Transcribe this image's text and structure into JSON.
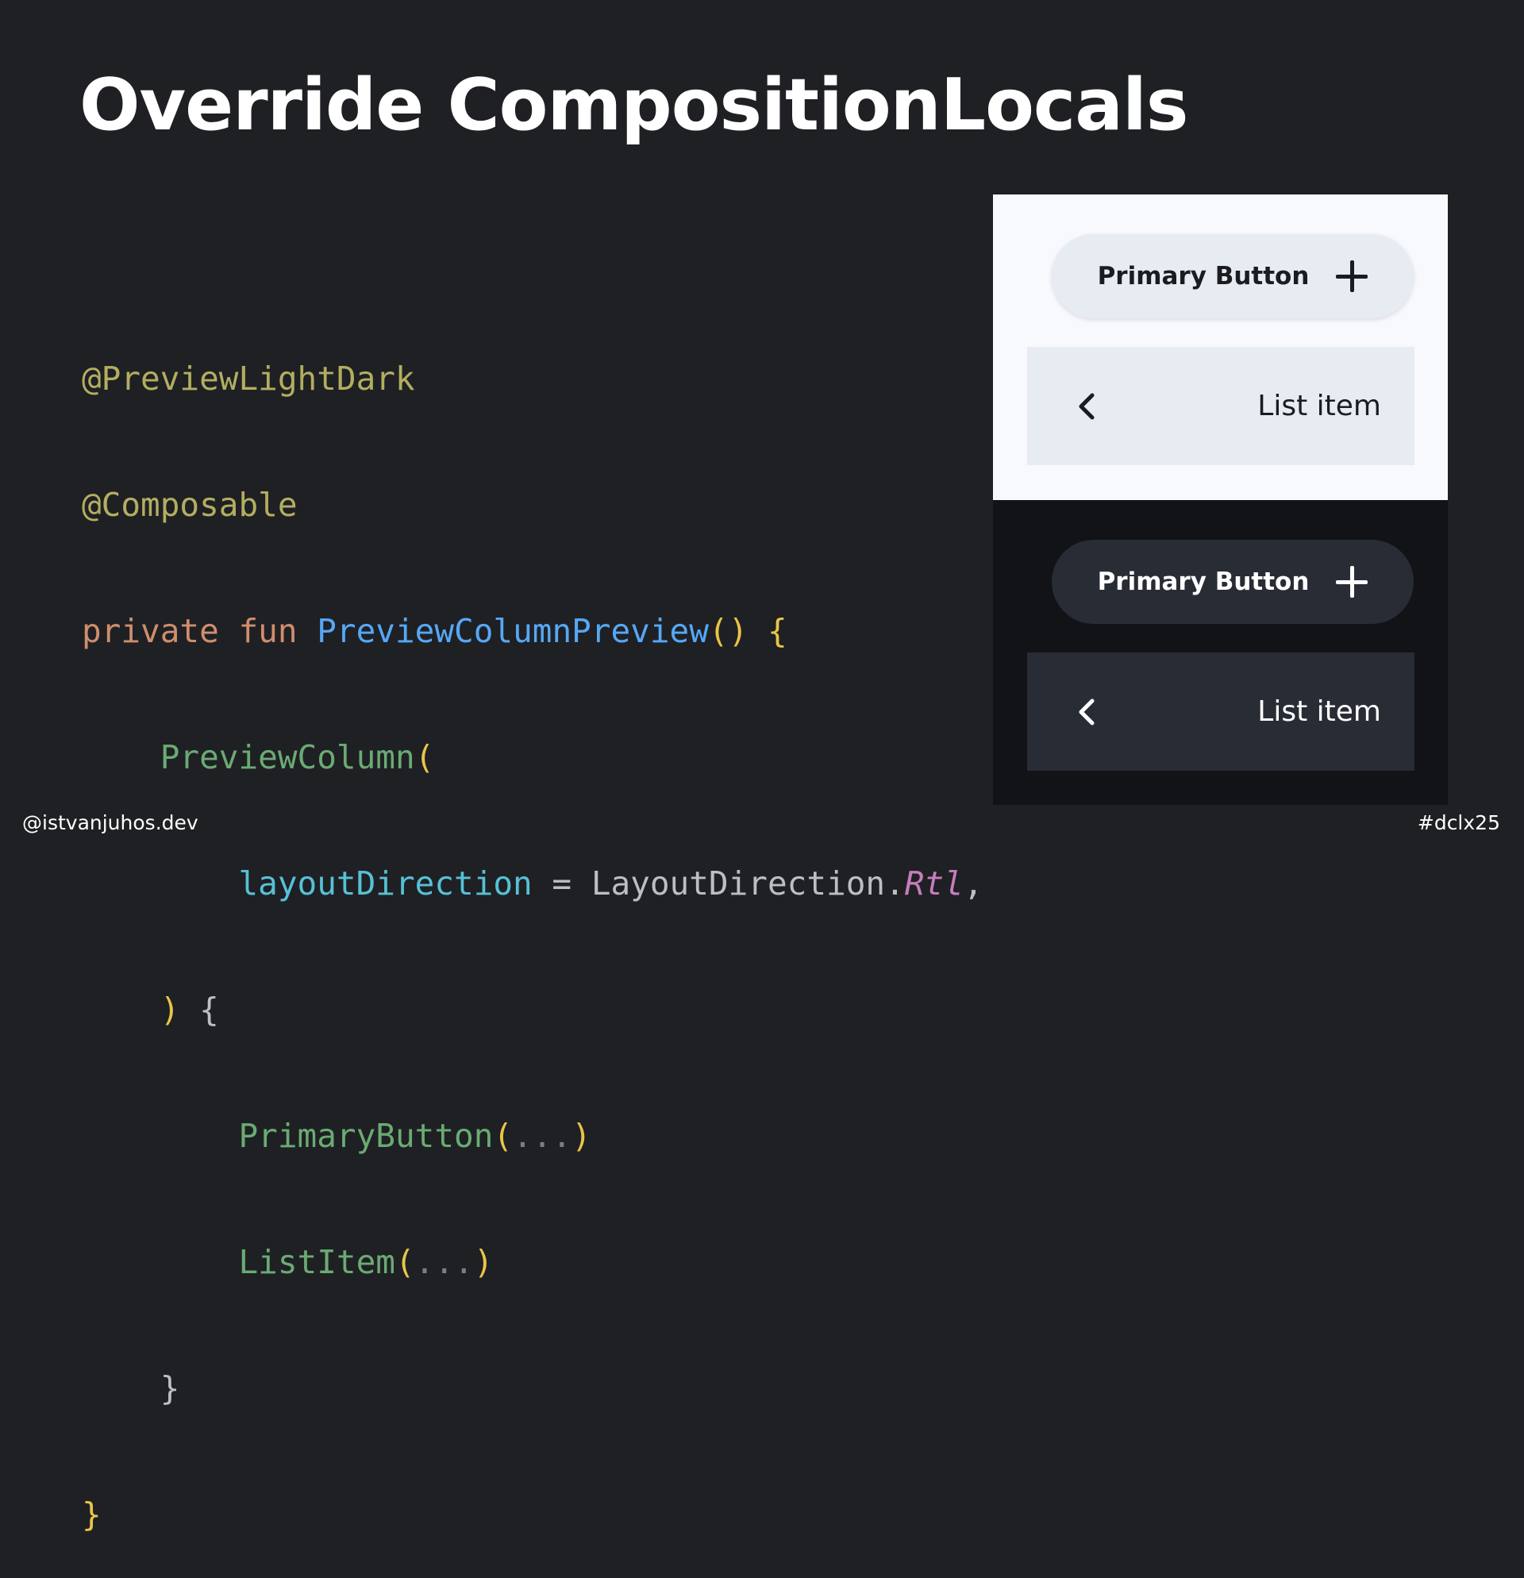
{
  "slide": {
    "title": "Override CompositionLocals",
    "footer_handle": "@istvanjuhos.dev",
    "footer_hashtag": "#dclx25"
  },
  "code": {
    "l1_annotation": "@PreviewLightDark",
    "l2_annotation": "@Composable",
    "l3_private": "private",
    "l3_fun": "fun",
    "l3_name": "PreviewColumnPreview",
    "l3_parens": "()",
    "l3_brace": "{",
    "l4_call": "PreviewColumn",
    "l4_paren": "(",
    "l5_param": "layoutDirection",
    "l5_eq": " = ",
    "l5_class": "LayoutDirection.",
    "l5_value": "Rtl",
    "l5_comma": ",",
    "l6_paren": ")",
    "l6_brace": "{",
    "l7_call": "PrimaryButton",
    "l7_open": "(",
    "l7_dots": "...",
    "l7_close": ")",
    "l8_call": "ListItem",
    "l8_open": "(",
    "l8_dots": "...",
    "l8_close": ")",
    "l9_brace": "}",
    "l10_brace": "}"
  },
  "preview_light": {
    "button_label": "Primary Button",
    "list_item_label": "List item"
  },
  "preview_dark": {
    "button_label": "Primary Button",
    "list_item_label": "List item"
  },
  "colors": {
    "background": "#1f2024",
    "light_surface": "#f8f9fd",
    "dark_surface": "#111317",
    "light_container": "#e7ebf2",
    "dark_container": "#282c35"
  },
  "icons": [
    "plus-icon",
    "chevron-left-icon"
  ]
}
